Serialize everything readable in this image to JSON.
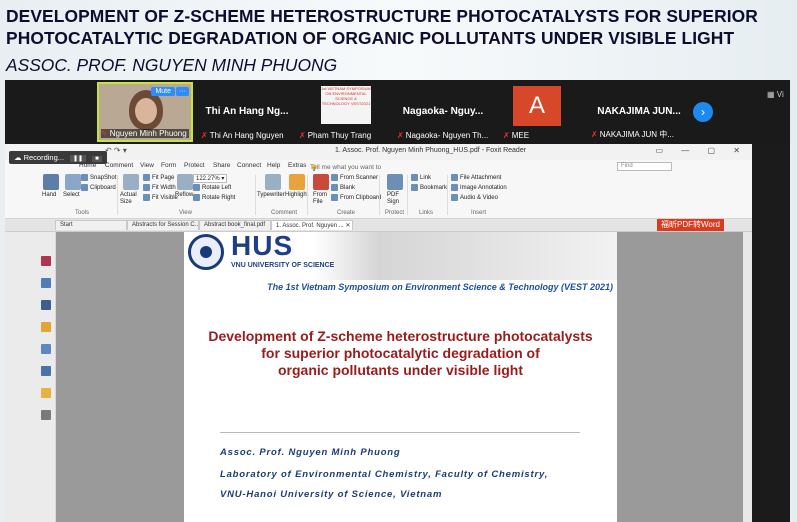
{
  "slide": {
    "title_line1": "DEVELOPMENT OF Z-SCHEME HETEROSTRUCTURE PHOTOCATALYSTS FOR SUPERIOR",
    "title_line2": "PHOTOCATALYTIC DEGRADATION OF ORGANIC POLLUTANTS UNDER VISIBLE LIGHT",
    "subtitle": "ASSOC. PROF. NGUYEN MINH PHUONG"
  },
  "participants": [
    {
      "name": "",
      "foot": "Nguyen Minh Phuong",
      "mute_label": "Mute",
      "more_label": "···"
    },
    {
      "name": "Thi An Hang Ng...",
      "foot": "Thi An Hang Nguyen"
    },
    {
      "name": "",
      "foot": "Pham Thuy Trang",
      "thumb_text": "1st VIETNAM SYMPOSIUM ON ENVIRONMENTAL SCIENCE & TECHNOLOGY VEST2021"
    },
    {
      "name": "Nagaoka- Nguy...",
      "foot": "Nagaoka- Nguyen Th..."
    },
    {
      "name": "",
      "foot": "MEE",
      "avatar": "A"
    },
    {
      "name": "NAKAJIMA JUN...",
      "foot": "NAKAJIMA JUN 中..."
    }
  ],
  "view_label": "Vi",
  "recording_label": "Recording...",
  "foxit": {
    "title": "1. Assoc. Prof. Nguyen Minh Phuong_HUS.pdf - Foxit Reader",
    "menu": [
      "Home",
      "Comment",
      "View",
      "Form",
      "Protect",
      "Share",
      "Connect",
      "Help",
      "Extras"
    ],
    "tell_me": "Tell me what you want to",
    "find_placeholder": "Find",
    "ribbon": {
      "hand": "Hand",
      "select": "Select",
      "snapshot": "SnapShot",
      "clipboard": "Clipboard",
      "actual_size": "Actual Size",
      "fit_page": "Fit Page",
      "fit_width": "Fit Width",
      "fit_visible": "Fit Visible",
      "zoom": "122.27%",
      "rotate_left": "Rotate Left",
      "rotate_right": "Rotate Right",
      "reflow": "Reflow",
      "typewriter": "Typewriter",
      "highlight": "Highlight",
      "from_file": "From File",
      "from_scanner": "From Scanner",
      "blank": "Blank",
      "from_clipboard": "From Clipboard",
      "pdf_sign": "PDF Sign",
      "link": "Link",
      "bookmark": "Bookmark",
      "file_attachment": "File Attachment",
      "image_annotation": "Image Annotation",
      "audio_video": "Audio & Video",
      "groups": [
        "Tools",
        "View",
        "Comment",
        "Create",
        "Protect",
        "Links",
        "Insert"
      ]
    },
    "tabs": [
      "Start",
      "Abstracts for Session C...",
      "Abstract book_final.pdf",
      "1. Assoc. Prof. Nguyen ..."
    ],
    "convert_button": "福昕PDF转Word"
  },
  "pdf": {
    "logo": "HUS",
    "university": "VNU UNIVERSITY OF SCIENCE",
    "symposium": "The 1st Vietnam Symposium on Environment Science & Technology (VEST 2021)",
    "title_line1": "Development of Z-scheme heterostructure photocatalysts",
    "title_line2": "for superior photocatalytic degradation of",
    "title_line3": "organic pollutants under visible light",
    "author": "Assoc. Prof. Nguyen Minh Phuong",
    "affiliation1": "Laboratory of Environmental Chemistry, Faculty of Chemistry,",
    "affiliation2": "VNU-Hanoi University of Science, Vietnam"
  }
}
